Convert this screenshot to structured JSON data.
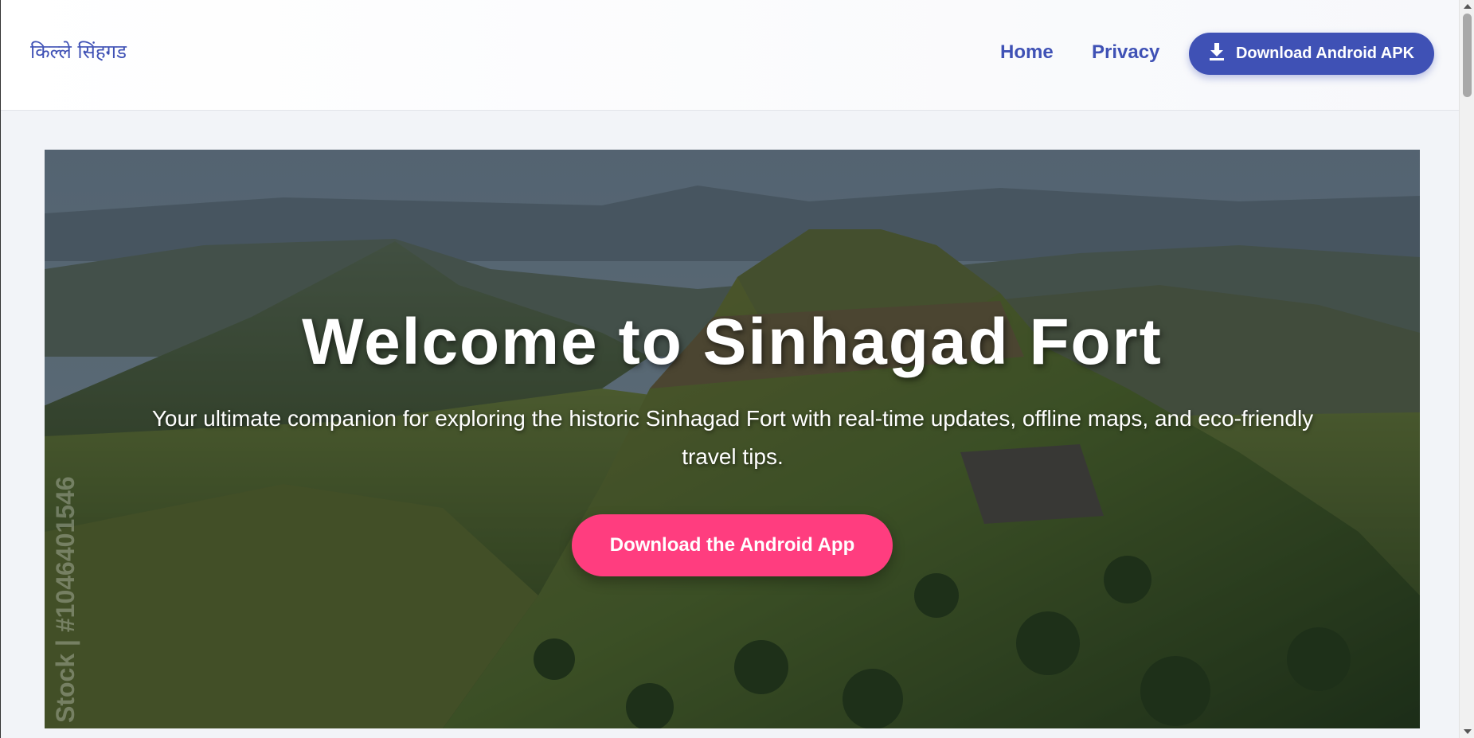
{
  "navbar": {
    "brand": "किल्ले सिंहगड",
    "links": {
      "home": "Home",
      "privacy": "Privacy"
    },
    "download_apk_label": "Download Android APK",
    "download_icon": "download-icon"
  },
  "hero": {
    "title": "Welcome to Sinhagad Fort",
    "subtitle": "Your ultimate companion for exploring the historic Sinhagad Fort with real-time updates, offline maps, and eco-friendly travel tips.",
    "cta_label": "Download the Android App",
    "watermark": "Stock | #1046401546"
  },
  "colors": {
    "brand": "#3f51b5",
    "cta": "#ff3d7f",
    "page_bg": "#f2f4f8"
  }
}
